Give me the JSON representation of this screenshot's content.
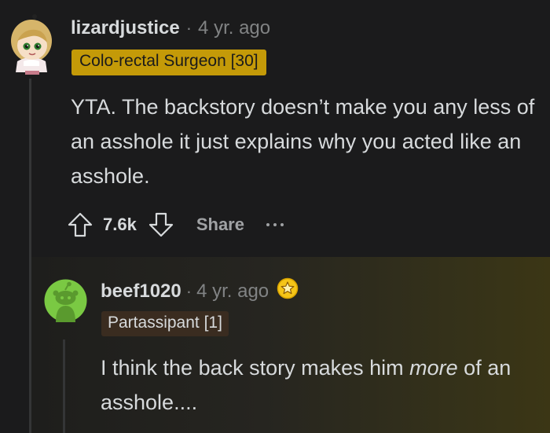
{
  "comments": [
    {
      "username": "lizardjustice",
      "separator": "·",
      "time_ago": "4 yr. ago",
      "flair": "Colo-rectal Surgeon [30]",
      "flair_color": "#c49a08",
      "body": "YTA. The backstory doesn’t make you any less of an asshole it just explains why you acted like an asshole.",
      "actions": {
        "upvote_icon": "upvote-icon",
        "vote_count": "7.6k",
        "downvote_icon": "downvote-icon",
        "share_label": "Share",
        "more_icon": "more-options-icon"
      }
    },
    {
      "username": "beef1020",
      "separator": "·",
      "time_ago": "4 yr. ago",
      "award_icon": "award-icon",
      "flair": "Partassipant [1]",
      "flair_color": "#3a2c20",
      "body_before": "I think the back story makes him ",
      "body_emphasis": "more",
      "body_after": " of an asshole...."
    }
  ]
}
